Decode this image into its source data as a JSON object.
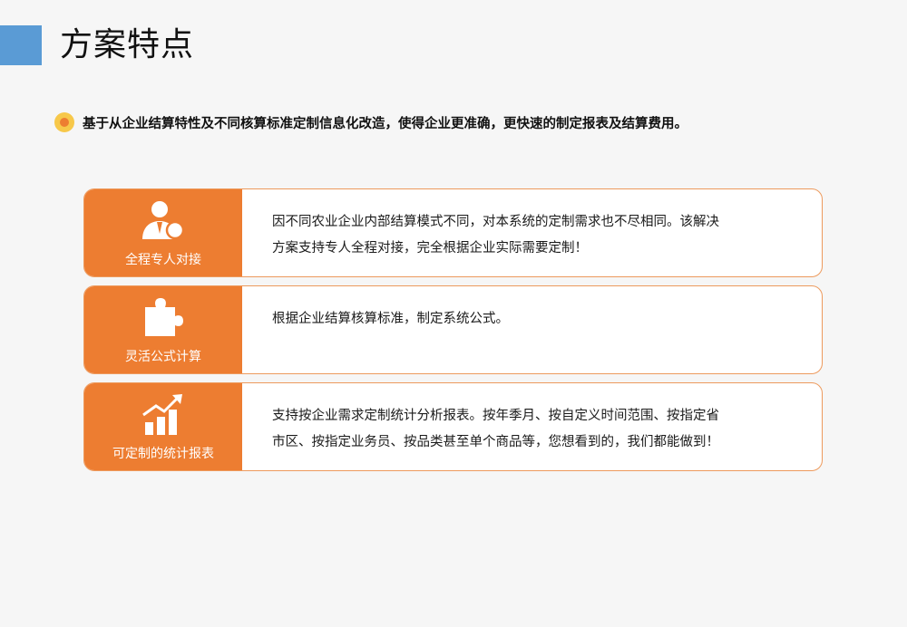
{
  "header": {
    "title": "方案特点"
  },
  "summary": {
    "text": "基于从企业结算特性及不同核算标准定制信息化改造，使得企业更准确，更快速的制定报表及结算费用。"
  },
  "features": [
    {
      "label": "全程专人对接",
      "icon": "person-icon",
      "description_lines": [
        "因不同农业企业内部结算模式不同，对本系统的定制需求也不尽相同。该解决",
        "方案支持专人全程对接，完全根据企业实际需要定制！"
      ]
    },
    {
      "label": "灵活公式计算",
      "icon": "puzzle-icon",
      "description_lines": [
        "根据企业结算核算标准，制定系统公式。"
      ]
    },
    {
      "label": "可定制的统计报表",
      "icon": "bar-chart-icon",
      "description_lines": [
        "支持按企业需求定制统计分析报表。按年季月、按自定义时间范围、按指定省",
        "市区、按指定业务员、按品类甚至单个商品等，您想看到的，我们都能做到！"
      ]
    }
  ],
  "colors": {
    "accent_blue": "#5a9bd5",
    "accent_orange": "#ed7d31",
    "bullet_yellow": "#f7c84a"
  }
}
